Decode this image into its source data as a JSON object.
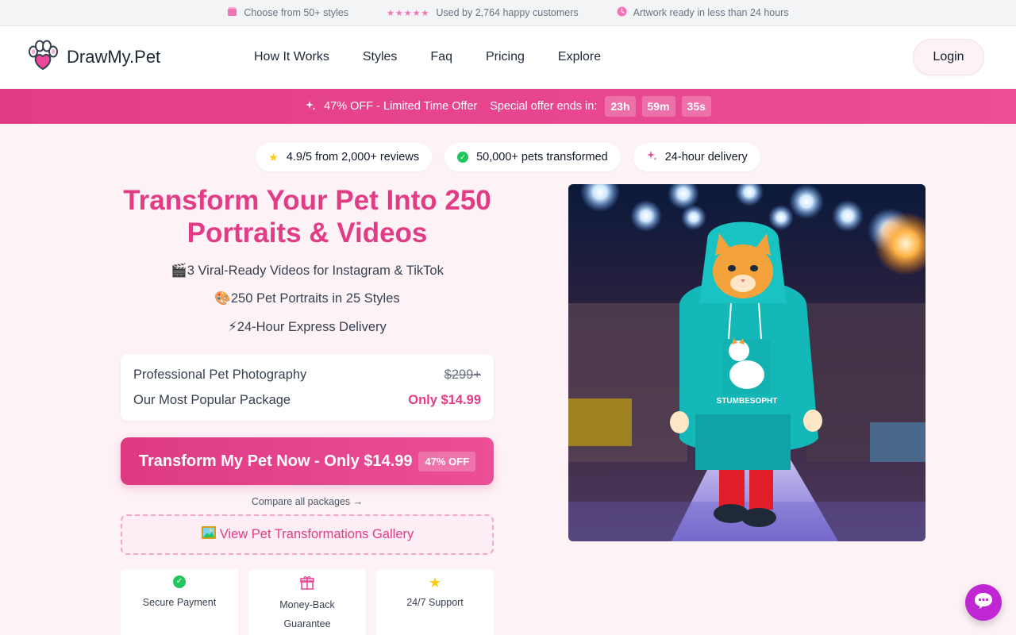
{
  "topbar": {
    "items": [
      {
        "icon": "box-icon",
        "text": "Choose from 50+ styles"
      },
      {
        "icon": "stars-icon",
        "text": "Used by 2,764 happy customers"
      },
      {
        "icon": "clock-icon",
        "text": "Artwork ready in less than 24 hours"
      }
    ]
  },
  "header": {
    "logo_text": "DrawMy.Pet",
    "nav": [
      "How It Works",
      "Styles",
      "Faq",
      "Pricing",
      "Explore"
    ],
    "login_label": "Login"
  },
  "promo": {
    "offer_text": "47% OFF - Limited Time Offer",
    "ends_text": "Special offer ends in:",
    "hours": "23h",
    "minutes": "59m",
    "seconds": "35s"
  },
  "badges": [
    {
      "icon": "star-icon",
      "text": "4.9/5 from 2,000+ reviews"
    },
    {
      "icon": "check-circle-icon",
      "text": "50,000+ pets transformed"
    },
    {
      "icon": "sparkle-icon",
      "text": "24-hour delivery"
    }
  ],
  "hero": {
    "title": "Transform Your Pet Into 250 Portraits & Videos",
    "features": [
      "🎬3 Viral-Ready Videos for Instagram & TikTok",
      "🎨250 Pet Portraits in 25 Styles",
      "⚡24-Hour Express Delivery"
    ],
    "pricing": [
      {
        "label": "Professional Pet Photography",
        "value": "$299+"
      },
      {
        "label": "Our Most Popular Package",
        "value": "Only $14.99"
      }
    ],
    "cta_label": "Transform My Pet Now - Only $14.99",
    "cta_badge": "47% OFF",
    "compare_link": "Compare all packages →",
    "gallery_label": "View Pet Transformations Gallery",
    "trust": [
      {
        "icon": "check-circle-icon",
        "text": "Secure Payment"
      },
      {
        "icon": "gift-icon",
        "text": "Money-Back Guarantee"
      },
      {
        "icon": "star-icon",
        "text": "24/7 Support"
      }
    ]
  },
  "image": {
    "shirt_text": "STUMBESOPHT"
  },
  "colors": {
    "brand": "#e23c86",
    "accent_light": "#fdf2f6",
    "chat": "#c026d3"
  }
}
